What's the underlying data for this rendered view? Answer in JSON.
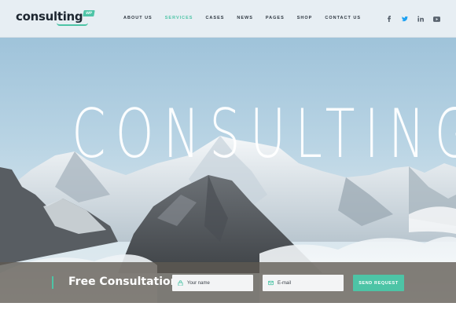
{
  "logo": {
    "text": "consulting",
    "badge": "WP"
  },
  "nav": {
    "items": [
      {
        "label": "ABOUT US",
        "active": false
      },
      {
        "label": "SERVICES",
        "active": true
      },
      {
        "label": "CASES",
        "active": false
      },
      {
        "label": "NEWS",
        "active": false
      },
      {
        "label": "PAGES",
        "active": false
      },
      {
        "label": "SHOP",
        "active": false
      },
      {
        "label": "CONTACT US",
        "active": false
      }
    ]
  },
  "social": [
    "facebook-icon",
    "twitter-icon",
    "linkedin-icon",
    "youtube-icon"
  ],
  "hero": {
    "title": "CONSULTING"
  },
  "consultation": {
    "title": "Free Consultation",
    "name_placeholder": "Your name",
    "email_placeholder": "E-mail",
    "button_label": "SEND REQUEST"
  },
  "colors": {
    "accent": "#4dc4a6",
    "dark": "#2d3640",
    "header_bg": "#e7eef3",
    "twitter": "#1da1f2"
  }
}
